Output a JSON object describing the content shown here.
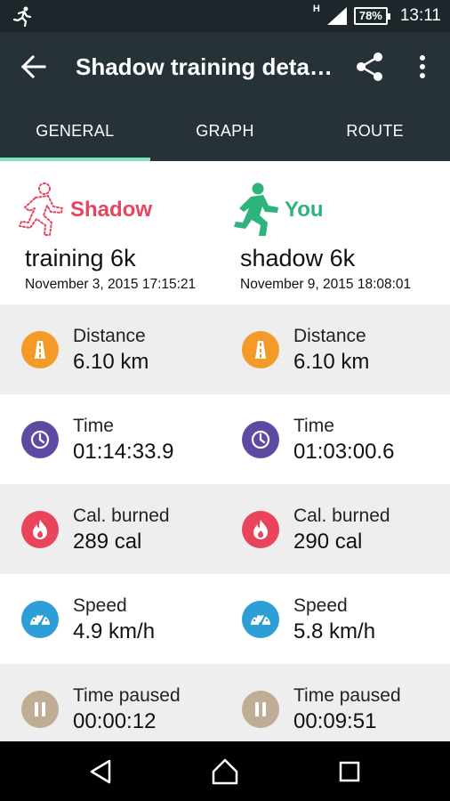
{
  "status_bar": {
    "network": "H",
    "battery": "78%",
    "time": "13:11"
  },
  "toolbar": {
    "title": "Shadow training detai…"
  },
  "tabs": [
    {
      "label": "GENERAL",
      "selected": true
    },
    {
      "label": "GRAPH",
      "selected": false
    },
    {
      "label": "ROUTE",
      "selected": false
    }
  ],
  "colors": {
    "shadow": "#e8445e",
    "you": "#2db37c",
    "distance_icon": "#f39a29",
    "time_icon": "#5d4ba3",
    "calories_icon": "#e9445b",
    "speed_icon": "#2e9ed6",
    "paused_icon": "#c0ad95"
  },
  "comparison": {
    "shadow": {
      "who": "Shadow",
      "activity": "training 6k",
      "datetime": "November 3, 2015 17:15:21",
      "icon": "dotted-runner-icon"
    },
    "you": {
      "who": "You",
      "activity": "shadow 6k",
      "datetime": "November 9, 2015 18:08:01",
      "icon": "runner-icon"
    }
  },
  "stats": [
    {
      "label": "Distance",
      "shadow": "6.10 km",
      "you": "6.10 km",
      "icon": "road-icon"
    },
    {
      "label": "Time",
      "shadow": "01:14:33.9",
      "you": "01:03:00.6",
      "icon": "clock-icon"
    },
    {
      "label": "Cal. burned",
      "shadow": "289 cal",
      "you": "290 cal",
      "icon": "flame-icon"
    },
    {
      "label": "Speed",
      "shadow": "4.9 km/h",
      "you": "5.8 km/h",
      "icon": "speedometer-icon"
    },
    {
      "label": "Time paused",
      "shadow": "00:00:12",
      "you": "00:09:51",
      "icon": "pause-icon"
    }
  ]
}
